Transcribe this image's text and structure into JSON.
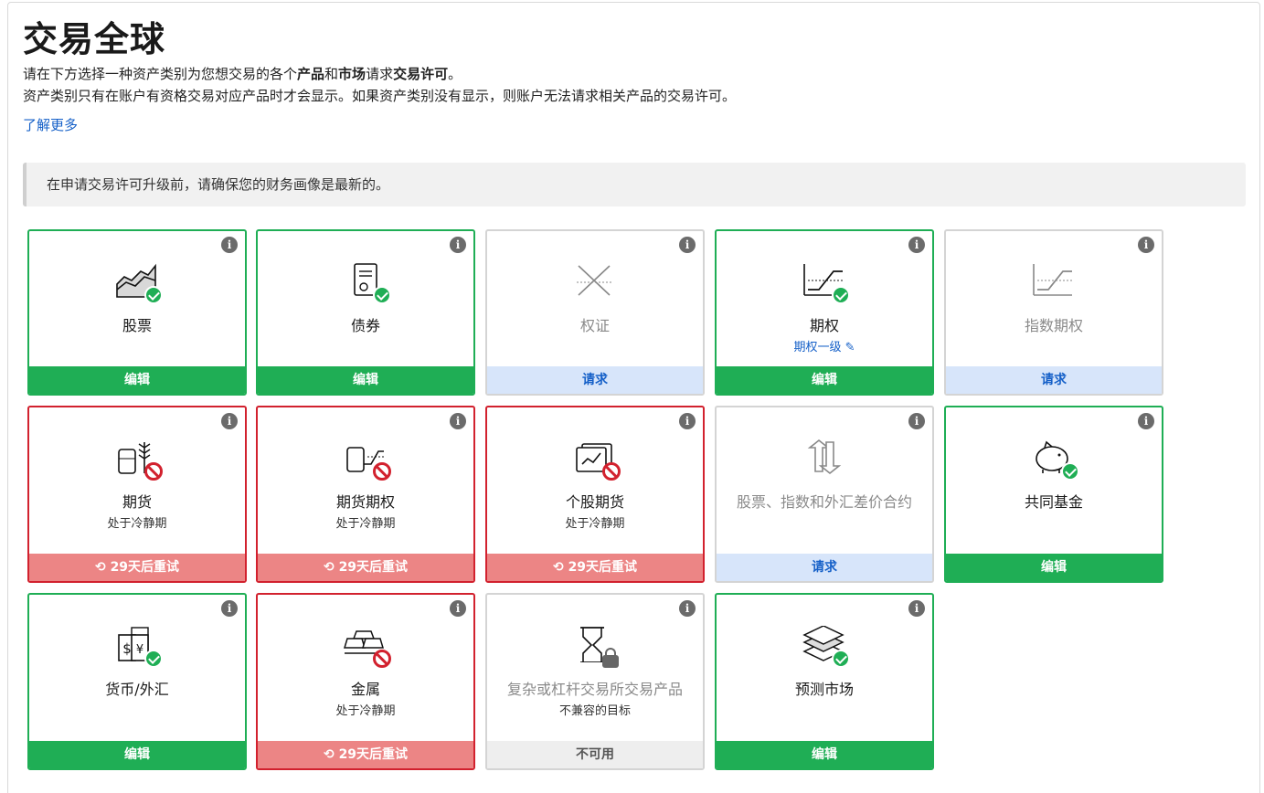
{
  "header": {
    "title": "交易全球",
    "desc1_a": "请在下方选择一种资产类别为您想交易的各个",
    "desc1_b": "产品",
    "desc1_c": "和",
    "desc1_d": "市场",
    "desc1_e": "请求",
    "desc1_f": "交易许可",
    "desc1_g": "。",
    "desc2": "资产类别只有在账户有资格交易对应产品时才会显示。如果资产类别没有显示，则账户无法请求相关产品的交易许可。",
    "learn_more": "了解更多"
  },
  "notice": "在申请交易许可升级前，请确保您的财务画像是最新的。",
  "info_glyph": "i",
  "colors": {
    "green": "#1fae55",
    "red": "#d2212e",
    "blue": "#1560c8",
    "request_bg": "#d7e5fa",
    "retry_bg": "#ec8585"
  },
  "cards": [
    {
      "name": "股票",
      "icon": "stocks-chart-icon",
      "badge": "approved",
      "action": "编辑"
    },
    {
      "name": "债券",
      "icon": "bond-certificate-icon",
      "badge": "approved",
      "action": "编辑"
    },
    {
      "name": "权证",
      "icon": "warrant-cross-icon",
      "action": "请求"
    },
    {
      "name": "期权",
      "icon": "option-payoff-icon",
      "badge": "approved",
      "sub": "期权一级",
      "sub_icon": "pencil-icon",
      "action": "编辑"
    },
    {
      "name": "指数期权",
      "icon": "index-option-payoff-icon",
      "action": "请求"
    },
    {
      "name": "期货",
      "icon": "futures-barrel-wheat-icon",
      "badge": "blocked",
      "sub": "处于冷静期",
      "action": "29天后重试"
    },
    {
      "name": "期货期权",
      "icon": "futures-option-icon",
      "badge": "blocked",
      "sub": "处于冷静期",
      "action": "29天后重试"
    },
    {
      "name": "个股期货",
      "icon": "single-stock-futures-icon",
      "badge": "blocked",
      "sub": "处于冷静期",
      "action": "29天后重试"
    },
    {
      "name": "股票、指数和外汇差价合约",
      "icon": "cfd-arrows-icon",
      "action": "请求"
    },
    {
      "name": "共同基金",
      "icon": "piggy-bank-icon",
      "badge": "approved",
      "action": "编辑"
    },
    {
      "name": "货币/外汇",
      "icon": "currency-notes-icon",
      "badge": "approved",
      "action": "编辑"
    },
    {
      "name": "金属",
      "icon": "gold-bars-icon",
      "badge": "blocked",
      "sub": "处于冷静期",
      "action": "29天后重试"
    },
    {
      "name": "复杂或杠杆交易所交易产品",
      "icon": "hourglass-icon",
      "badge": "locked",
      "sub": "不兼容的目标",
      "action": "不可用"
    },
    {
      "name": "预测市场",
      "icon": "stacked-layers-icon",
      "badge": "approved",
      "action": "编辑"
    }
  ]
}
